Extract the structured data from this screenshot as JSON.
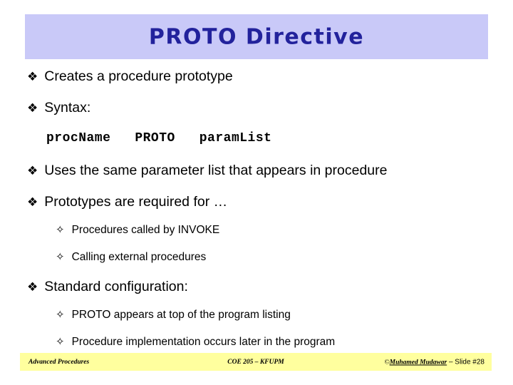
{
  "slide": {
    "title": "PROTO Directive",
    "title_band_color": "#c9c9f8",
    "title_text_color": "#22229c",
    "background_color": "#ffffff"
  },
  "bullets": {
    "level1_glyph": "❖",
    "level2_glyph": "✧",
    "items": [
      {
        "level": 1,
        "text": "Creates a procedure prototype"
      },
      {
        "level": 1,
        "text": "Syntax:"
      },
      {
        "level": 1,
        "text": "Uses the same parameter list that appears in procedure"
      },
      {
        "level": 1,
        "text": "Prototypes are required for …"
      },
      {
        "level": 2,
        "text": "Procedures called by INVOKE"
      },
      {
        "level": 2,
        "text": "Calling external procedures"
      },
      {
        "level": 1,
        "text": "Standard configuration:"
      },
      {
        "level": 2,
        "text": "PROTO appears at top of the program listing"
      },
      {
        "level": 2,
        "text": "Procedure implementation occurs later in the program"
      }
    ]
  },
  "code": {
    "syntax_line": "procName   PROTO   paramList"
  },
  "footer": {
    "band_color": "#ffff9e",
    "left": "Advanced Procedures",
    "center": "COE 205 – KFUPM",
    "copyright_symbol": "©",
    "author": "Muhamed Mudawar",
    "slide_label": " – Slide #28"
  }
}
